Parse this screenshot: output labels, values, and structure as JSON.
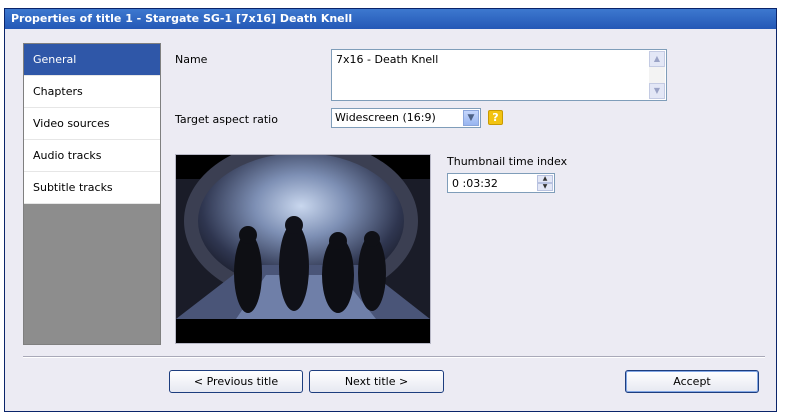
{
  "window": {
    "title": "Properties of title 1 - Stargate SG-1 [7x16] Death Knell"
  },
  "sidebar": {
    "items": [
      {
        "label": "General",
        "active": true
      },
      {
        "label": "Chapters"
      },
      {
        "label": "Video sources"
      },
      {
        "label": "Audio tracks"
      },
      {
        "label": "Subtitle tracks"
      }
    ]
  },
  "form": {
    "name_label": "Name",
    "name_value": "7x16 - Death Knell",
    "aspect_label": "Target aspect ratio",
    "aspect_value": "Widescreen (16:9)",
    "help_icon": "?",
    "thumbnail_label": "Thumbnail time index",
    "thumbnail_time": "0 :03:32"
  },
  "buttons": {
    "previous": "< Previous title",
    "next": "Next title >",
    "accept": "Accept"
  },
  "colors": {
    "titlebar": "#2f5fbd",
    "sidebar_active": "#2f57a8",
    "help": "#f2c312"
  }
}
